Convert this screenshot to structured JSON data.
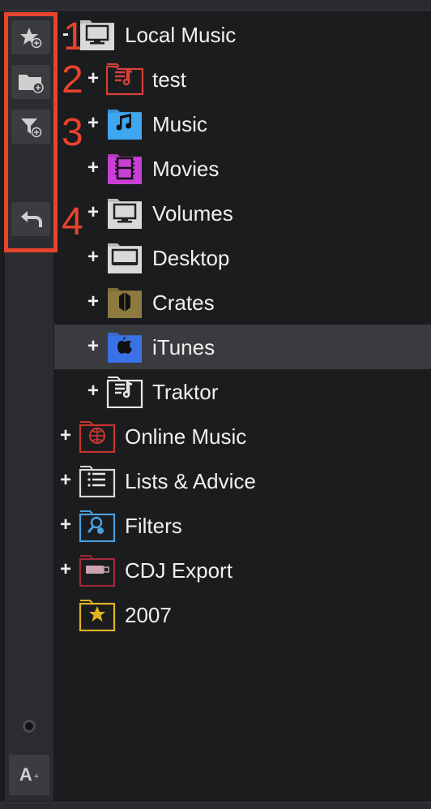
{
  "sidebar": {
    "buttons": [
      {
        "name": "add-favorite",
        "icon": "star-plus-icon"
      },
      {
        "name": "add-folder",
        "icon": "folder-plus-icon"
      },
      {
        "name": "add-filter",
        "icon": "filter-plus-icon"
      },
      {
        "name": "back",
        "icon": "return-arrow-icon"
      }
    ],
    "font_button_label": "A",
    "font_button_suffix": "+"
  },
  "annotations": {
    "markers": [
      "1",
      "2",
      "3",
      "4"
    ],
    "color": "#e8432c"
  },
  "tree": {
    "items": [
      {
        "label": "Local Music",
        "expander": "-",
        "icon": "monitor-icon",
        "level": 0,
        "folder_color": "#d9d9d9"
      },
      {
        "label": "test",
        "expander": "+",
        "icon": "playlist-icon",
        "level": 1,
        "folder_color": "#d8403a"
      },
      {
        "label": "Music",
        "expander": "+",
        "icon": "music-note-icon",
        "level": 1,
        "folder_color": "#3fa6f0"
      },
      {
        "label": "Movies",
        "expander": "+",
        "icon": "film-icon",
        "level": 1,
        "folder_color": "#c93fd6"
      },
      {
        "label": "Volumes",
        "expander": "+",
        "icon": "monitor-icon",
        "level": 1,
        "folder_color": "#d9d9d9"
      },
      {
        "label": "Desktop",
        "expander": "+",
        "icon": "desktop-icon",
        "level": 1,
        "folder_color": "#d9d9d9"
      },
      {
        "label": "Crates",
        "expander": "+",
        "icon": "crate-icon",
        "level": 1,
        "folder_color": "#8c7a3e"
      },
      {
        "label": "iTunes",
        "expander": "+",
        "icon": "apple-icon",
        "level": 1,
        "folder_color": "#3a72e6",
        "selected": true
      },
      {
        "label": "Traktor",
        "expander": "+",
        "icon": "playlist-icon",
        "level": 1,
        "folder_color": "#e8e8e8"
      },
      {
        "label": "Online Music",
        "expander": "+",
        "icon": "globe-icon",
        "level": 0,
        "folder_color": "#c8342e"
      },
      {
        "label": "Lists & Advice",
        "expander": "+",
        "icon": "list-icon",
        "level": 0,
        "folder_color": "#d9d9d9"
      },
      {
        "label": "Filters",
        "expander": "+",
        "icon": "search-filter-icon",
        "level": 0,
        "folder_color": "#4a9fe0"
      },
      {
        "label": "CDJ Export",
        "expander": "+",
        "icon": "usb-drive-icon",
        "level": 0,
        "folder_color": "#9e2a3a"
      },
      {
        "label": "2007",
        "expander": "",
        "icon": "star-icon",
        "level": 0,
        "folder_color": "#e0b420"
      }
    ]
  }
}
